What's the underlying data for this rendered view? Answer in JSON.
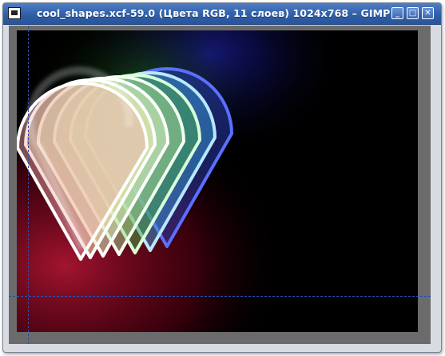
{
  "window": {
    "title": "cool_shapes.xcf-59.0 (Цвета RGB, 11 слоев) 1024x768 – GIMP",
    "buttons": {
      "minimize_icon": "minimize-icon",
      "maximize_icon": "maximize-icon",
      "close_icon": "close-icon"
    }
  },
  "canvas": {
    "background_color": "#000000",
    "guides_color": "#2a4fae",
    "shape_colors": [
      "#e0505a",
      "#e8c070",
      "#ffffe0",
      "#e0ffe0",
      "#a0ffa0",
      "#80d0ff",
      "#4060ff"
    ]
  }
}
